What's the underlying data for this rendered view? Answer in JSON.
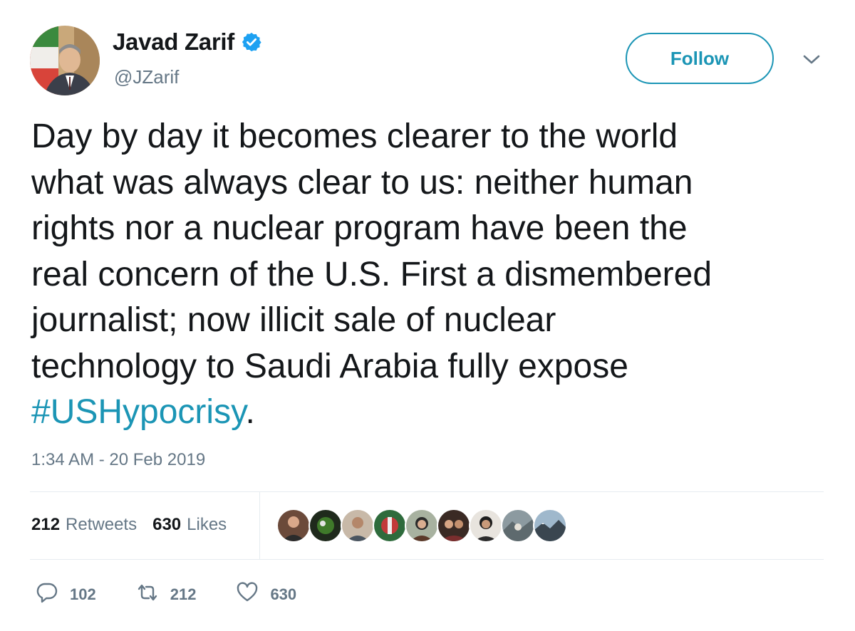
{
  "user": {
    "display_name": "Javad Zarif",
    "handle": "@JZarif",
    "verified": true
  },
  "follow_button": {
    "label": "Follow"
  },
  "tweet": {
    "text_lines": [
      "Day by day it becomes clearer to the world",
      "what was always clear to us: neither human",
      "rights nor a nuclear program have been the",
      "real concern of the U.S. First a dismembered",
      "journalist; now illicit sale of nuclear",
      "technology to Saudi Arabia fully expose"
    ],
    "hashtag": "#USHypocrisy",
    "trailing": ".",
    "timestamp": "1:34 AM - 20 Feb 2019"
  },
  "stats": {
    "retweets_count": "212",
    "retweets_label": "Retweets",
    "likes_count": "630",
    "likes_label": "Likes"
  },
  "actions": {
    "replies": "102",
    "retweets": "212",
    "likes": "630"
  },
  "colors": {
    "accent": "#1b95b5",
    "muted": "#657786",
    "text": "#14171a",
    "verified": "#1da1f2"
  },
  "icons": {
    "verified": "verified-badge-icon",
    "chevron": "chevron-down-icon",
    "reply": "reply-icon",
    "retweet": "retweet-icon",
    "like": "heart-icon"
  }
}
